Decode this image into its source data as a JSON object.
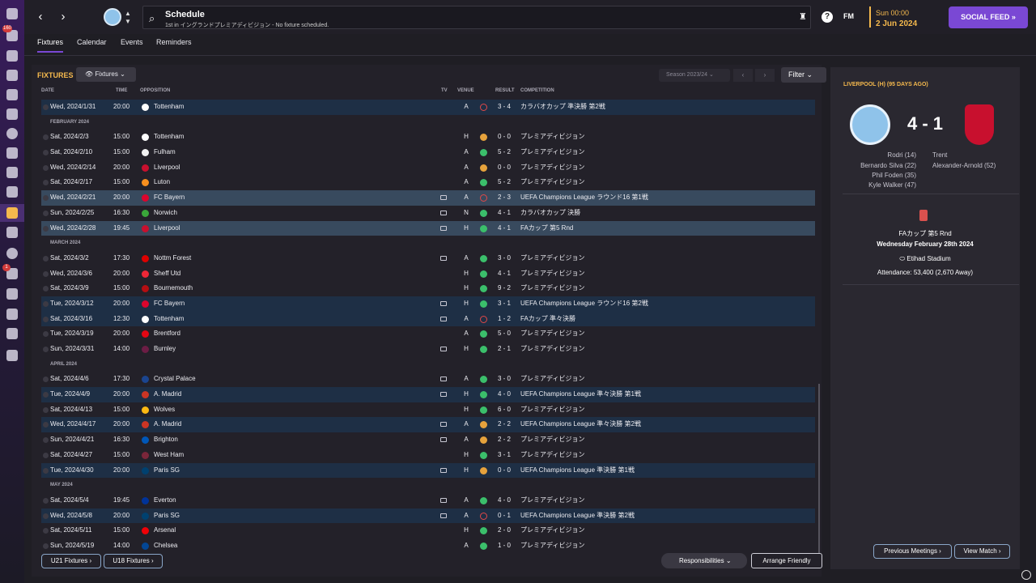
{
  "topbar": {
    "title": "Schedule",
    "subtitle": "1st in イングランドプレミアディビジョン - No fixture scheduled.",
    "fm_label": "FM",
    "help_label": "?",
    "time": "Sun 00:00",
    "date": "2 Jun 2024",
    "social_feed_label": "SOCIAL FEED"
  },
  "rail": {
    "badges": [
      "160",
      "1",
      "1"
    ]
  },
  "tabs": [
    "Fixtures",
    "Calendar",
    "Events",
    "Reminders"
  ],
  "fixtures": {
    "title": "FIXTURES",
    "dropdown_label": "Fixtures",
    "season_label": "Season 2023/24",
    "filter_label": "Filter",
    "columns": {
      "date": "DATE",
      "time": "TIME",
      "opposition": "OPPOSITION",
      "tv": "TV",
      "venue": "VENUE",
      "result": "RESULT",
      "competition": "COMPETITION"
    },
    "u21_label": "U21 Fixtures",
    "u18_label": "U18 Fixtures",
    "responsibilities_label": "Responsibilities",
    "arrange_label": "Arrange Friendly"
  },
  "fixture_rows": [
    {
      "date": "Wed, 2024/1/31",
      "time": "20:00",
      "opp": "Tottenham",
      "tv": false,
      "venue": "A",
      "res": "l",
      "score": "3 - 4",
      "comp": "カラバオカップ 準決勝 第2戦",
      "style": "alt",
      "crest": "#ffffff"
    },
    {
      "header": "FEBRUARY 2024"
    },
    {
      "date": "Sat, 2024/2/3",
      "time": "15:00",
      "opp": "Tottenham",
      "tv": false,
      "venue": "H",
      "res": "d",
      "score": "0 - 0",
      "comp": "プレミアディビジョン",
      "style": "",
      "crest": "#ffffff"
    },
    {
      "date": "Sat, 2024/2/10",
      "time": "15:00",
      "opp": "Fulham",
      "tv": false,
      "venue": "A",
      "res": "w",
      "score": "5 - 2",
      "comp": "プレミアディビジョン",
      "style": "",
      "crest": "#f2f2f2"
    },
    {
      "date": "Wed, 2024/2/14",
      "time": "20:00",
      "opp": "Liverpool",
      "tv": false,
      "venue": "A",
      "res": "d",
      "score": "0 - 0",
      "comp": "プレミアディビジョン",
      "style": "",
      "crest": "#c8102e"
    },
    {
      "date": "Sat, 2024/2/17",
      "time": "15:00",
      "opp": "Luton",
      "tv": false,
      "venue": "A",
      "res": "w",
      "score": "5 - 2",
      "comp": "プレミアディビジョン",
      "style": "",
      "crest": "#f78f1e"
    },
    {
      "date": "Wed, 2024/2/21",
      "time": "20:00",
      "opp": "FC Bayern",
      "tv": true,
      "venue": "A",
      "res": "l",
      "score": "2 - 3",
      "comp": "UEFA Champions League ラウンド16 第1戦",
      "style": "hl",
      "crest": "#dc052d"
    },
    {
      "date": "Sun, 2024/2/25",
      "time": "16:30",
      "opp": "Norwich",
      "tv": true,
      "venue": "N",
      "res": "w",
      "score": "4 - 1",
      "comp": "カラバオカップ 決勝",
      "style": "",
      "crest": "#3aa63a"
    },
    {
      "date": "Wed, 2024/2/28",
      "time": "19:45",
      "opp": "Liverpool",
      "tv": true,
      "venue": "H",
      "res": "w",
      "score": "4 - 1",
      "comp": "FAカップ 第5 Rnd",
      "style": "hl",
      "crest": "#c8102e"
    },
    {
      "header": "MARCH 2024"
    },
    {
      "date": "Sat, 2024/3/2",
      "time": "17:30",
      "opp": "Nottm Forest",
      "tv": true,
      "venue": "A",
      "res": "w",
      "score": "3 - 0",
      "comp": "プレミアディビジョン",
      "style": "",
      "crest": "#dd0000"
    },
    {
      "date": "Wed, 2024/3/6",
      "time": "20:00",
      "opp": "Sheff Utd",
      "tv": false,
      "venue": "H",
      "res": "w",
      "score": "4 - 1",
      "comp": "プレミアディビジョン",
      "style": "",
      "crest": "#ee2737"
    },
    {
      "date": "Sat, 2024/3/9",
      "time": "15:00",
      "opp": "Bournemouth",
      "tv": false,
      "venue": "H",
      "res": "w",
      "score": "9 - 2",
      "comp": "プレミアディビジョン",
      "style": "",
      "crest": "#b50e12"
    },
    {
      "date": "Tue, 2024/3/12",
      "time": "20:00",
      "opp": "FC Bayern",
      "tv": true,
      "venue": "H",
      "res": "w",
      "score": "3 - 1",
      "comp": "UEFA Champions League ラウンド16 第2戦",
      "style": "alt",
      "crest": "#dc052d"
    },
    {
      "date": "Sat, 2024/3/16",
      "time": "12:30",
      "opp": "Tottenham",
      "tv": true,
      "venue": "A",
      "res": "l",
      "score": "1 - 2",
      "comp": "FAカップ 準々決勝",
      "style": "alt",
      "crest": "#ffffff"
    },
    {
      "date": "Tue, 2024/3/19",
      "time": "20:00",
      "opp": "Brentford",
      "tv": false,
      "venue": "A",
      "res": "w",
      "score": "5 - 0",
      "comp": "プレミアディビジョン",
      "style": "",
      "crest": "#e30613"
    },
    {
      "date": "Sun, 2024/3/31",
      "time": "14:00",
      "opp": "Burnley",
      "tv": true,
      "venue": "H",
      "res": "w",
      "score": "2 - 1",
      "comp": "プレミアディビジョン",
      "style": "",
      "crest": "#6c1d45"
    },
    {
      "header": "APRIL 2024"
    },
    {
      "date": "Sat, 2024/4/6",
      "time": "17:30",
      "opp": "Crystal Palace",
      "tv": true,
      "venue": "A",
      "res": "w",
      "score": "3 - 0",
      "comp": "プレミアディビジョン",
      "style": "",
      "crest": "#1b458f"
    },
    {
      "date": "Tue, 2024/4/9",
      "time": "20:00",
      "opp": "A. Madrid",
      "tv": true,
      "venue": "H",
      "res": "w",
      "score": "4 - 0",
      "comp": "UEFA Champions League 準々決勝 第1戦",
      "style": "alt",
      "crest": "#cb3524"
    },
    {
      "date": "Sat, 2024/4/13",
      "time": "15:00",
      "opp": "Wolves",
      "tv": false,
      "venue": "H",
      "res": "w",
      "score": "6 - 0",
      "comp": "プレミアディビジョン",
      "style": "",
      "crest": "#fdb913"
    },
    {
      "date": "Wed, 2024/4/17",
      "time": "20:00",
      "opp": "A. Madrid",
      "tv": true,
      "venue": "A",
      "res": "d",
      "score": "2 - 2",
      "comp": "UEFA Champions League 準々決勝 第2戦",
      "style": "alt",
      "crest": "#cb3524"
    },
    {
      "date": "Sun, 2024/4/21",
      "time": "16:30",
      "opp": "Brighton",
      "tv": true,
      "venue": "A",
      "res": "d",
      "score": "2 - 2",
      "comp": "プレミアディビジョン",
      "style": "",
      "crest": "#0057b8"
    },
    {
      "date": "Sat, 2024/4/27",
      "time": "15:00",
      "opp": "West Ham",
      "tv": false,
      "venue": "H",
      "res": "w",
      "score": "3 - 1",
      "comp": "プレミアディビジョン",
      "style": "",
      "crest": "#7a263a"
    },
    {
      "date": "Tue, 2024/4/30",
      "time": "20:00",
      "opp": "Paris SG",
      "tv": true,
      "venue": "H",
      "res": "d",
      "score": "0 - 0",
      "comp": "UEFA Champions League 準決勝 第1戦",
      "style": "alt",
      "crest": "#004170"
    },
    {
      "header": "MAY 2024"
    },
    {
      "date": "Sat, 2024/5/4",
      "time": "19:45",
      "opp": "Everton",
      "tv": true,
      "venue": "A",
      "res": "w",
      "score": "4 - 0",
      "comp": "プレミアディビジョン",
      "style": "",
      "crest": "#003399"
    },
    {
      "date": "Wed, 2024/5/8",
      "time": "20:00",
      "opp": "Paris SG",
      "tv": true,
      "venue": "A",
      "res": "l",
      "score": "0 - 1",
      "comp": "UEFA Champions League 準決勝 第2戦",
      "style": "alt",
      "crest": "#004170"
    },
    {
      "date": "Sat, 2024/5/11",
      "time": "15:00",
      "opp": "Arsenal",
      "tv": false,
      "venue": "H",
      "res": "w",
      "score": "2 - 0",
      "comp": "プレミアディビジョン",
      "style": "",
      "crest": "#ef0107"
    },
    {
      "date": "Sun, 2024/5/19",
      "time": "14:00",
      "opp": "Chelsea",
      "tv": false,
      "venue": "A",
      "res": "w",
      "score": "1 - 0",
      "comp": "プレミアディビジョン",
      "style": "",
      "crest": "#034694"
    }
  ],
  "match": {
    "title": "LIVERPOOL (H) (95 DAYS AGO)",
    "score": "4 - 1",
    "home_scorers": [
      "Rodri (14)",
      "Bernardo Silva (22)",
      "Phil Foden (35)",
      "Kyle Walker (47)"
    ],
    "away_scorers": [
      "Trent",
      "Alexander-Arnold (52)"
    ],
    "competition": "FAカップ 第5 Rnd",
    "date": "Wednesday February 28th 2024",
    "stadium": "Etihad Stadium",
    "attendance": "Attendance: 53,400 (2,670 Away)",
    "prev_label": "Previous Meetings",
    "view_label": "View Match"
  },
  "colors": {
    "accent": "#7a48d4",
    "highlight": "#f5b94d",
    "win": "#3bbf6b",
    "draw": "#e6a23c",
    "loss": "#e04848"
  }
}
